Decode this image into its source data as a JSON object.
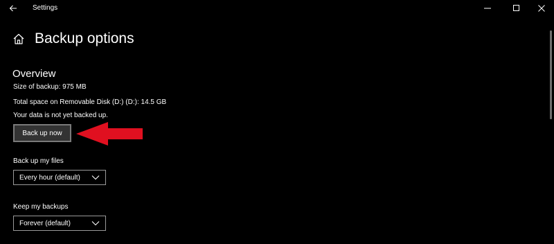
{
  "window": {
    "title": "Settings",
    "controls": [
      "minimize-icon",
      "maximize-icon",
      "close-icon"
    ]
  },
  "header": {
    "icon": "home-icon",
    "title": "Backup options"
  },
  "overview": {
    "heading": "Overview",
    "size_line": "Size of backup: 975 MB",
    "space_line": "Total space on Removable Disk (D:) (D:): 14.5 GB",
    "status_line": "Your data is not yet backed up.",
    "backup_button": "Back up now"
  },
  "settings": {
    "backup_frequency": {
      "label": "Back up my files",
      "value": "Every hour (default)"
    },
    "retention": {
      "label": "Keep my backups",
      "value": "Forever (default)"
    }
  },
  "colors": {
    "background": "#000000",
    "text": "#ffffff",
    "button_bg": "#333333",
    "annotation_arrow": "#e01020"
  }
}
